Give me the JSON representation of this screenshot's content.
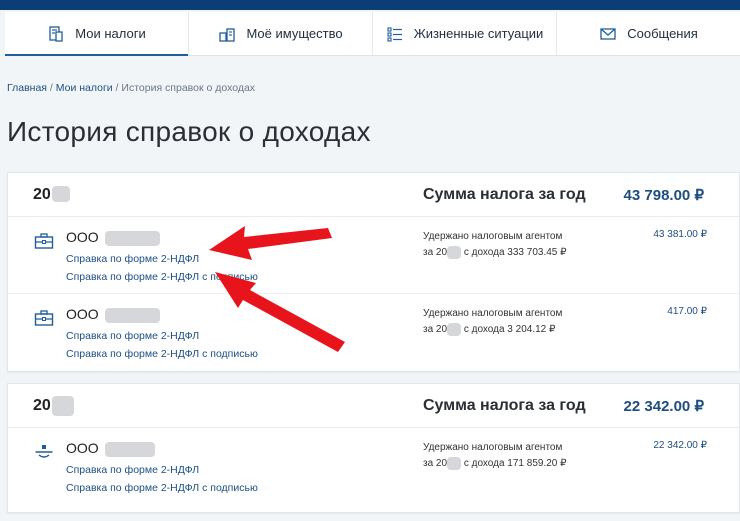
{
  "tabs": [
    {
      "label": "Мои налоги",
      "icon": "taxes-icon"
    },
    {
      "label": "Моё имущество",
      "icon": "property-icon"
    },
    {
      "label": "Жизненные ситуации",
      "icon": "list-icon"
    },
    {
      "label": "Сообщения",
      "icon": "envelope-icon"
    }
  ],
  "breadcrumb": {
    "home": "Главная",
    "sep1": " / ",
    "taxes": "Мои налоги",
    "sep2": " / ",
    "current": "История справок о доходах"
  },
  "page_title": "История справок о доходах",
  "years": [
    {
      "year": "20",
      "sum_label": "Сумма налога за год",
      "sum_value": "43 798.00 ₽",
      "entries": [
        {
          "org": "ООО",
          "link1": "Справка по форме 2-НДФЛ",
          "link2": "Справка по форме 2-НДФЛ с подписью",
          "withheld_line1": "Удержано налоговым агентом",
          "withheld_line2_prefix": "за 20",
          "withheld_line2_suffix": " с дохода 333 703.45 ₽",
          "amount": "43 381.00 ₽"
        },
        {
          "org": "ООО",
          "link1": "Справка по форме 2-НДФЛ",
          "link2": "Справка по форме 2-НДФЛ с подписью",
          "withheld_line1": "Удержано налоговым агентом",
          "withheld_line2_prefix": "за 20",
          "withheld_line2_suffix": " с дохода 3 204.12 ₽",
          "amount": "417.00 ₽"
        }
      ]
    },
    {
      "year": "20",
      "sum_label": "Сумма налога за год",
      "sum_value": "22 342.00 ₽",
      "entries": [
        {
          "org": "ООО",
          "link1": "Справка по форме 2-НДФЛ",
          "link2": "Справка по форме 2-НДФЛ с подписью",
          "withheld_line1": "Удержано налоговым агентом",
          "withheld_line2_prefix": "за 20",
          "withheld_line2_suffix": " с дохода 171 859.20 ₽",
          "amount": "22 342.00 ₽"
        }
      ]
    }
  ],
  "colors": {
    "topbar": "#0b3e74",
    "link": "#1c4f86",
    "annotation_arrow": "#e8141c"
  }
}
